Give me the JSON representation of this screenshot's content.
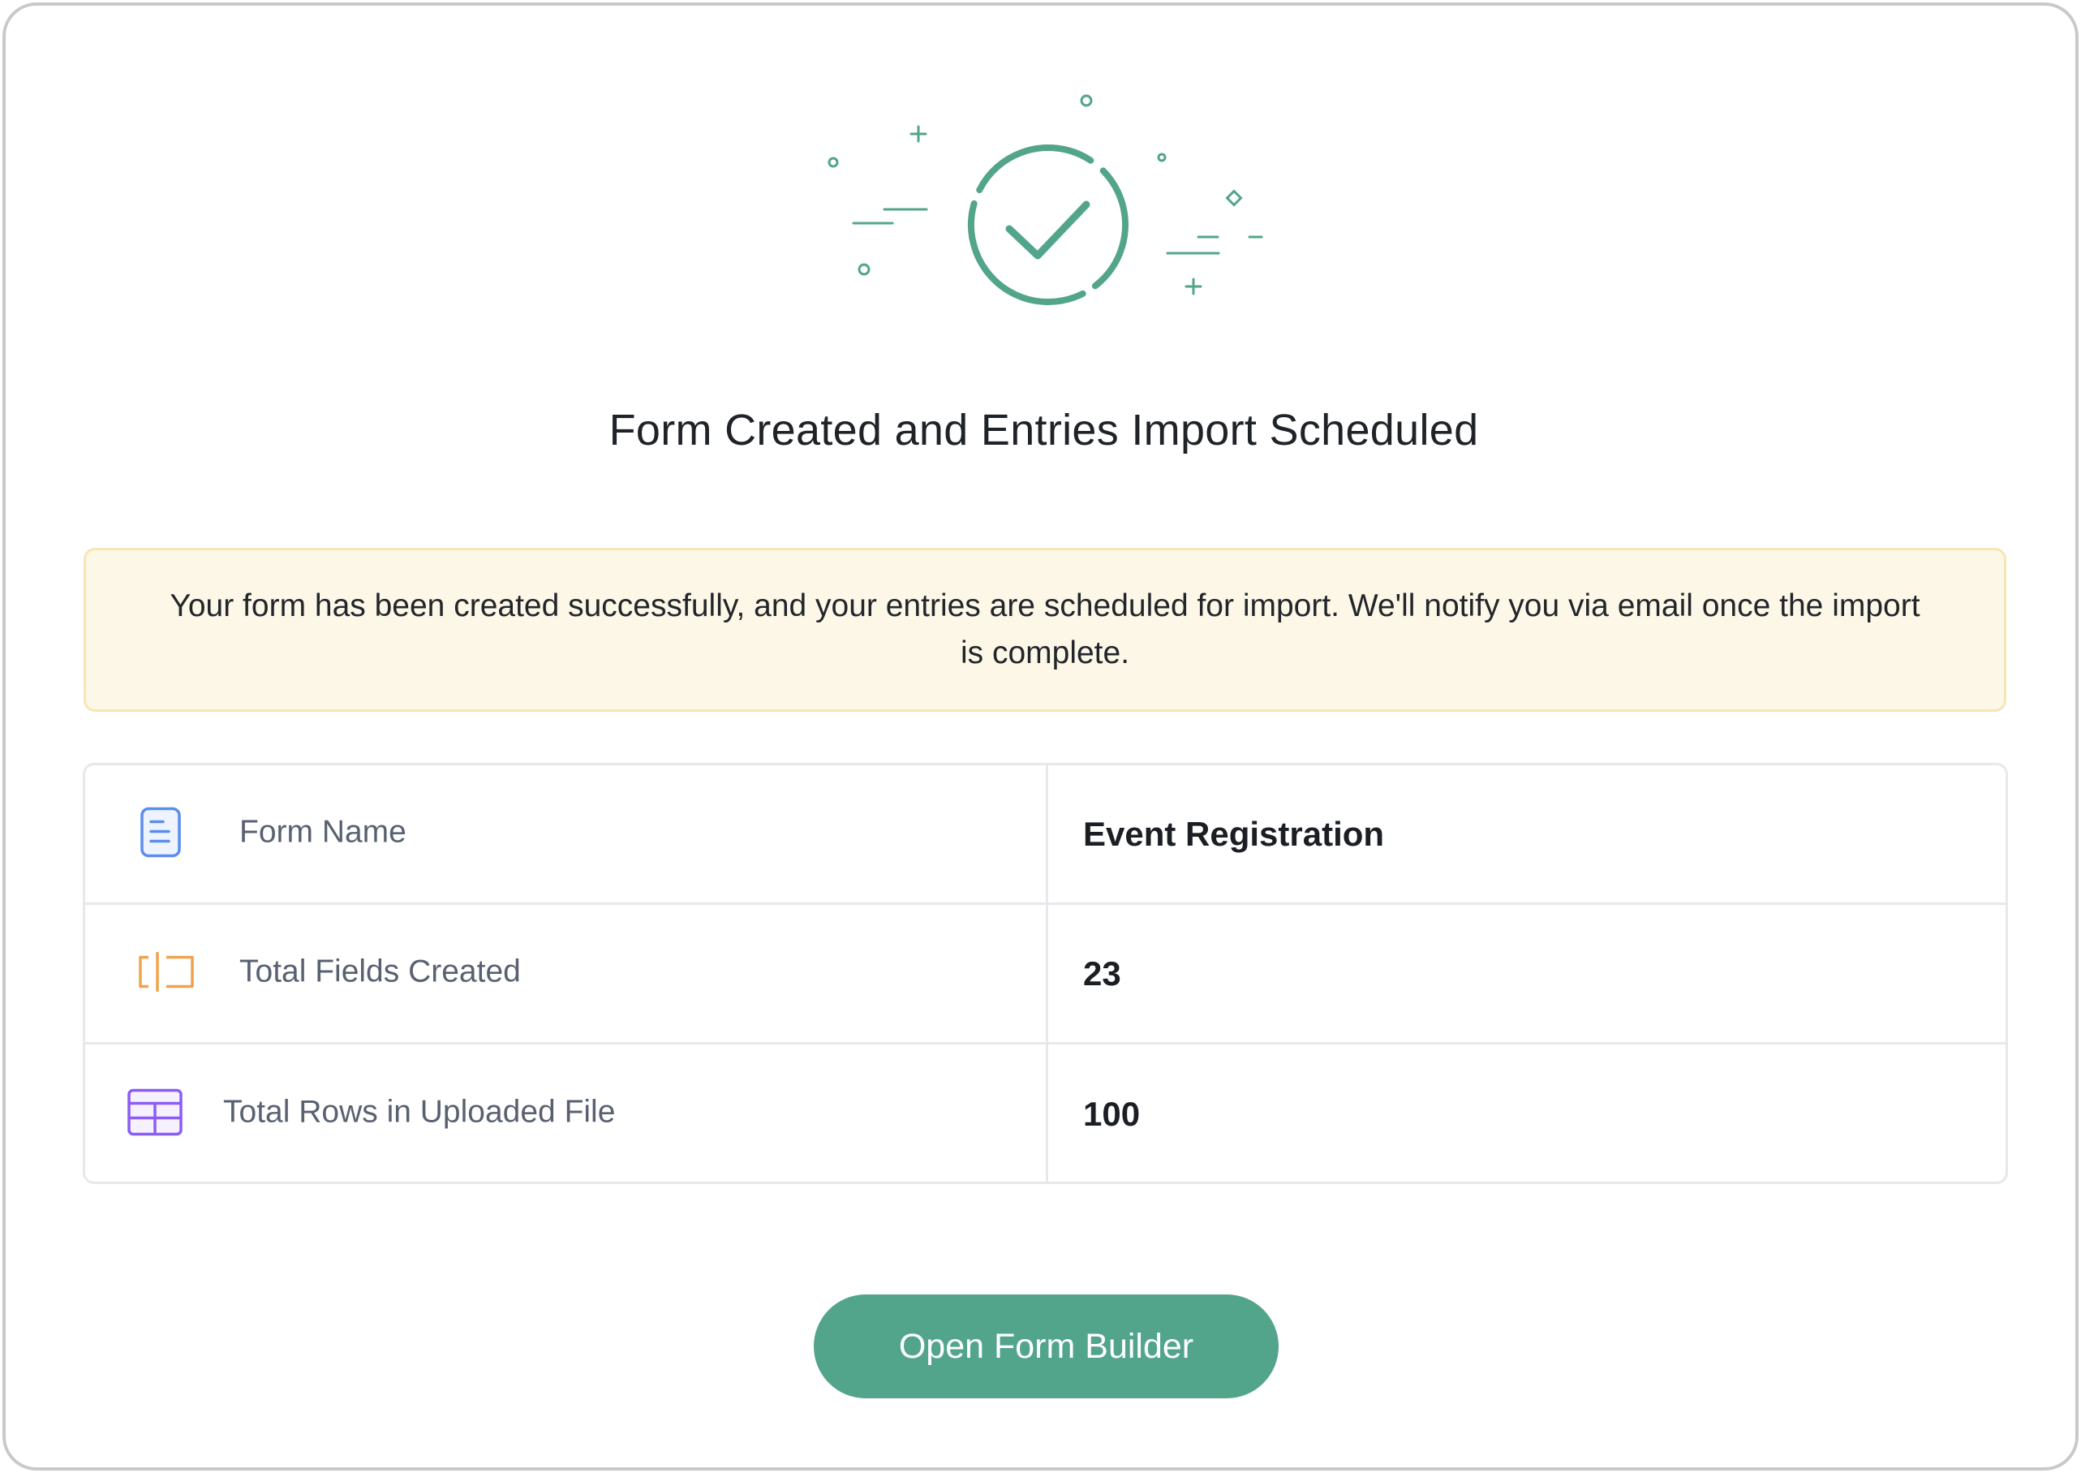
{
  "dialog": {
    "title": "Form Created and Entries Import Scheduled",
    "notice": "Your form has been created successfully, and your entries are scheduled for import. We'll notify you via email once the import is complete."
  },
  "illustration": {
    "icon": "success-check-icon",
    "color": "#52a58b"
  },
  "summary": {
    "rows": [
      {
        "icon": "document-icon",
        "icon_color": "#5b8def",
        "label": "Form Name",
        "value": "Event Registration"
      },
      {
        "icon": "text-field-icon",
        "icon_color": "#f0a24d",
        "label": "Total Fields Created",
        "value": "23"
      },
      {
        "icon": "table-icon",
        "icon_color": "#8b5cf6",
        "label": "Total Rows in Uploaded File",
        "value": "100"
      }
    ]
  },
  "actions": {
    "open_form_builder_label": "Open Form Builder",
    "button_color": "#52a58b"
  },
  "colors": {
    "notice_bg": "#fdf7e8",
    "notice_border": "#f6e6b4",
    "border": "#e6e8eb"
  }
}
